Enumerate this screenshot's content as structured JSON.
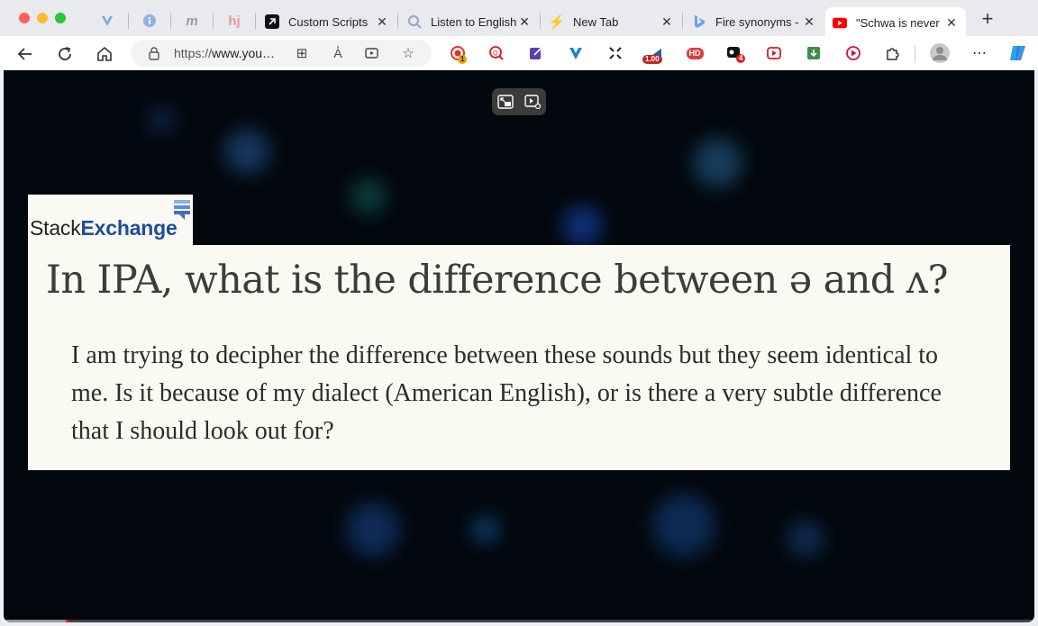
{
  "browser": {
    "tabs": [
      {
        "title": "Custom Scripts",
        "favicon": "arrow-square-icon"
      },
      {
        "title": "Listen to English",
        "favicon": "search-magnifier-icon"
      },
      {
        "title": "New Tab",
        "favicon": "bolt-icon"
      },
      {
        "title": "Fire synonyms -",
        "favicon": "bing-icon"
      },
      {
        "title": "\"Schwa is never",
        "favicon": "youtube-icon",
        "active": true
      }
    ],
    "pinned_tabs": [
      "v-logo-icon",
      "info-icon",
      "m-logo-icon",
      "hj-logo-icon"
    ],
    "address": {
      "prefix": "https://",
      "host": "www.you…"
    },
    "extension_badges": {
      "first": "1",
      "speed": "1.00",
      "hd": "HD",
      "count": "4"
    }
  },
  "video": {
    "source_brand": {
      "stack": "Stack",
      "exchange": "Exchange"
    },
    "question_title": "In IPA, what is the difference between ə and ʌ?",
    "question_body": "I am trying to decipher the difference between these sounds but they seem identical to me. Is it because of my dialect (American English), or is there a very subtle difference that I should look out for?",
    "progress_fraction": 0.063
  },
  "colors": {
    "accent_red": "#ff0033",
    "stack_blue": "#1d4e9a",
    "card_bg": "#fbfaf2"
  }
}
